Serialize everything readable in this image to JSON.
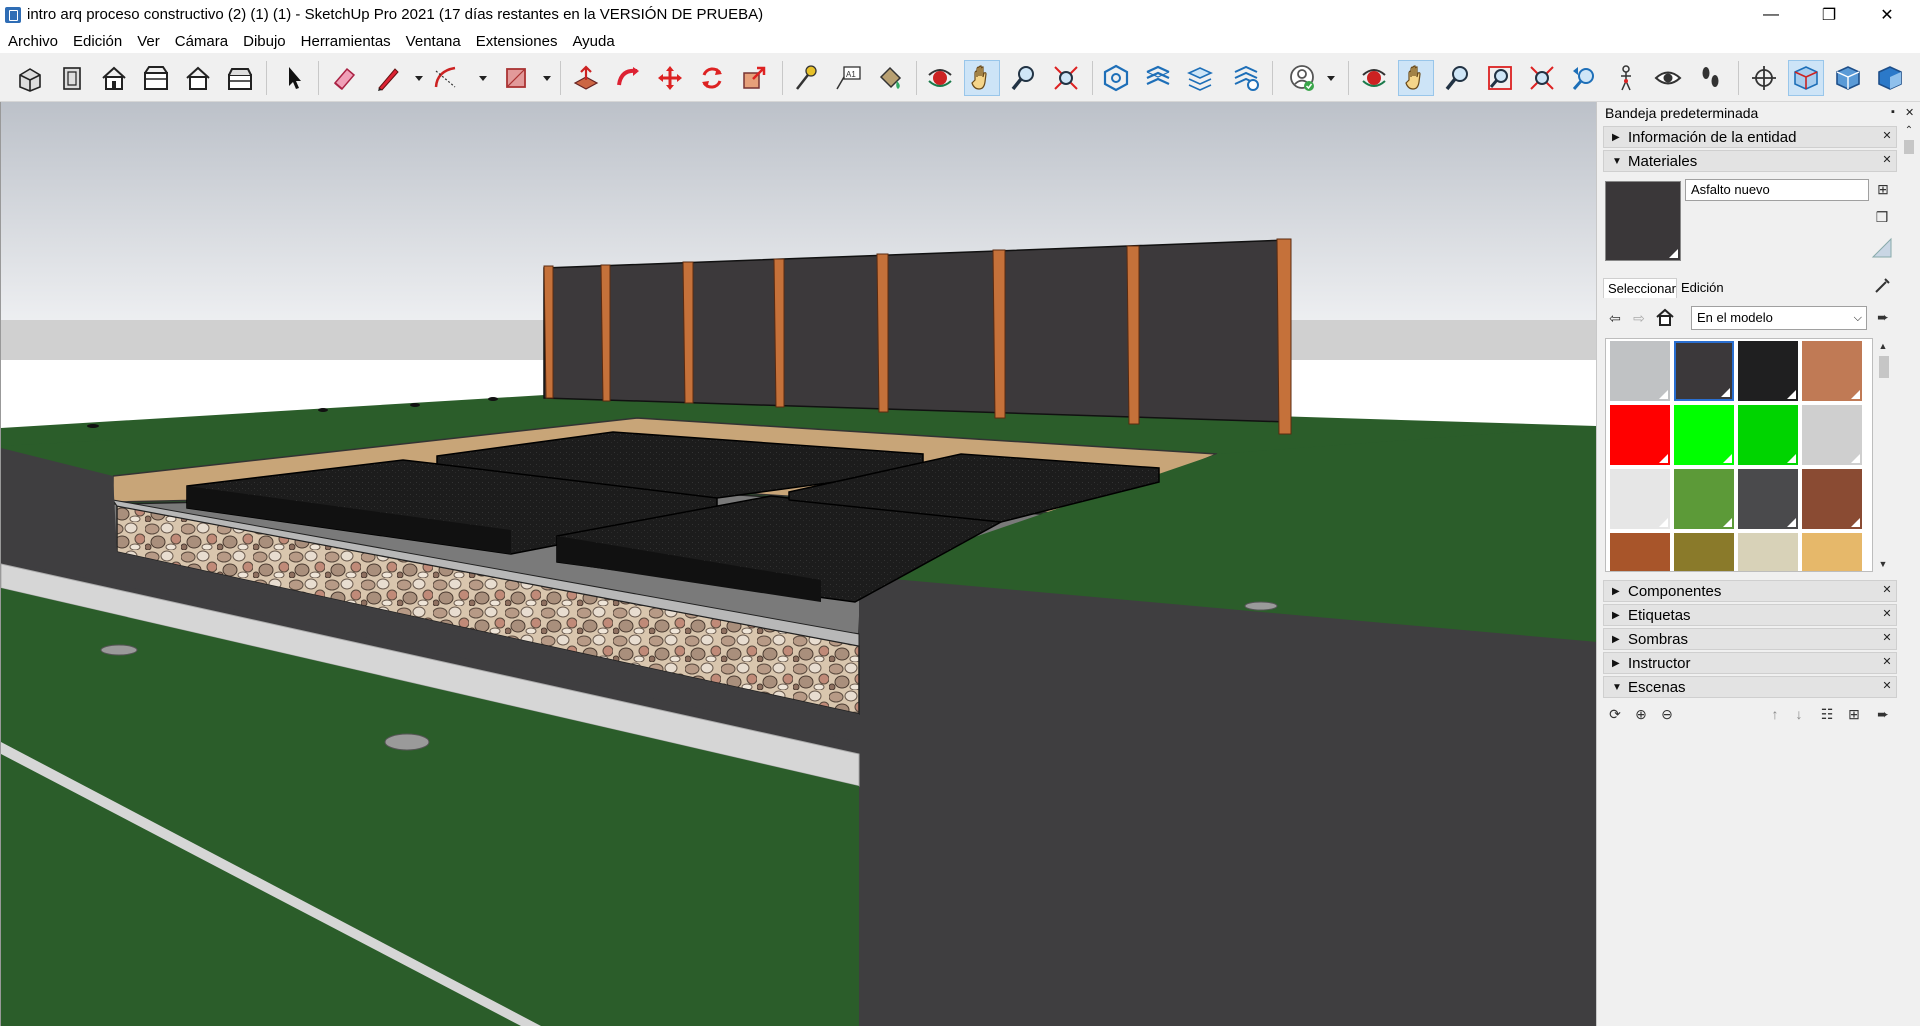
{
  "window": {
    "title": "intro arq proceso constructivo (2) (1) (1) - SketchUp Pro 2021 (17 días restantes en la VERSIÓN DE PRUEBA)",
    "minimize": "—",
    "restore": "❐",
    "close": "✕"
  },
  "menu": [
    "Archivo",
    "Edición",
    "Ver",
    "Cámara",
    "Dibujo",
    "Herramientas",
    "Ventana",
    "Extensiones",
    "Ayuda"
  ],
  "tray": {
    "title": "Bandeja predeterminada",
    "pin": "▪",
    "close": "✕",
    "panels": {
      "entity_info": "Información de la entidad",
      "materials": "Materiales",
      "components": "Componentes",
      "tags": "Etiquetas",
      "shadows": "Sombras",
      "instructor": "Instructor",
      "scenes": "Escenas"
    },
    "materials": {
      "current_name": "Asfalto nuevo",
      "tab_select": "Seleccionar",
      "tab_edit": "Edición",
      "library": "En el modelo",
      "swatch_colors": [
        "#c0c2c4",
        "#3b383a",
        "#1f1f20",
        "#c07a55",
        "#ff0000",
        "#00ff00",
        "#00d400",
        "#cfcfcf",
        "#e6e6e6",
        "#5c9a38",
        "#4a4a4c",
        "#8a4b33",
        "#a8552a",
        "#8a7a2a",
        "#d8d2b8",
        "#e6b86a"
      ],
      "selected_index": 1
    }
  },
  "colors": {
    "accent_blue": "#2a6fd0",
    "sky_top": "#bcc1c9",
    "grass": "#2b5d2a",
    "asphalt": "#1c1c1c",
    "soil": "#c8a578",
    "post": "#c5713a",
    "fence": "#3c393b"
  }
}
